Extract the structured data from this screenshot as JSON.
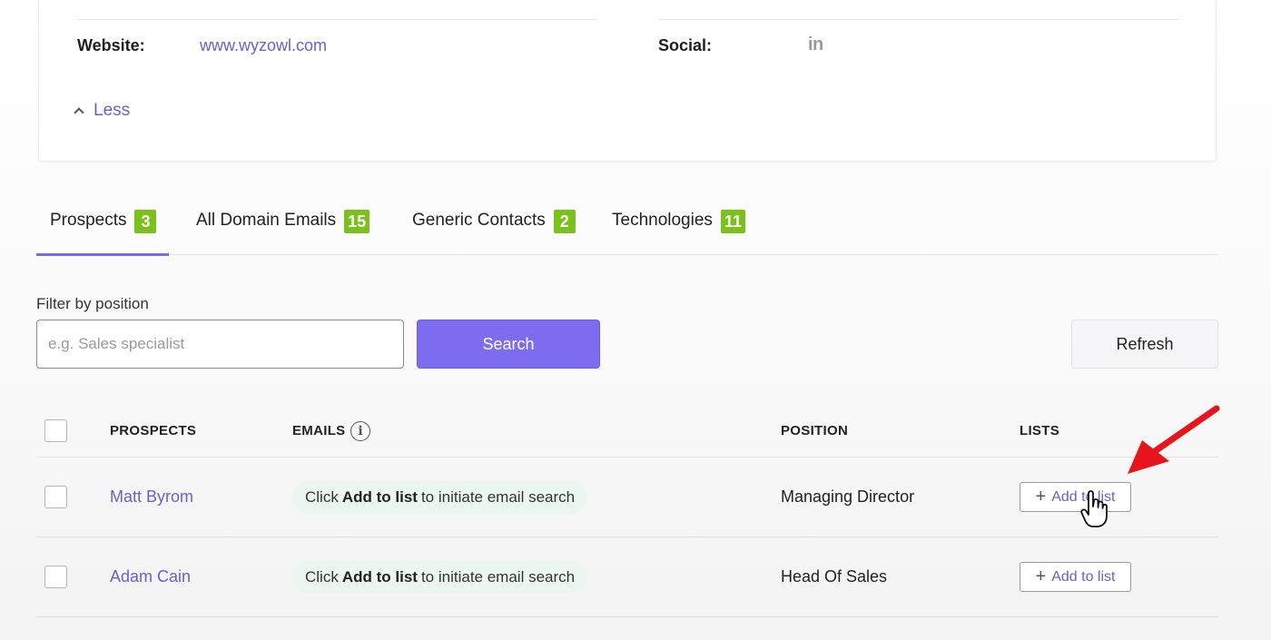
{
  "details": {
    "website_label": "Website:",
    "website_value": "www.wyzowl.com",
    "social_label": "Social:",
    "social_icon": "linkedin-icon",
    "social_text": "in",
    "less_label": "Less"
  },
  "tabs": [
    {
      "label": "Prospects",
      "count": "3",
      "active": true
    },
    {
      "label": "All Domain Emails",
      "count": "15",
      "active": false
    },
    {
      "label": "Generic Contacts",
      "count": "2",
      "active": false
    },
    {
      "label": "Technologies",
      "count": "11",
      "active": false
    }
  ],
  "filter": {
    "label": "Filter by position",
    "placeholder": "e.g. Sales specialist",
    "value": "",
    "search_label": "Search",
    "refresh_label": "Refresh"
  },
  "table": {
    "headers": [
      "PROSPECTS",
      "EMAILS",
      "POSITION",
      "LISTS"
    ],
    "rows": [
      {
        "name": "Matt Byrom",
        "email_prefix": "Click",
        "email_bold": "Add to list",
        "email_suffix": "to initiate email search",
        "position": "Managing Director",
        "list_button": "Add to list"
      },
      {
        "name": "Adam Cain",
        "email_prefix": "Click",
        "email_bold": "Add to list",
        "email_suffix": "to initiate email search",
        "position": "Head Of Sales",
        "list_button": "Add to list"
      }
    ]
  },
  "colors": {
    "accent": "#7c6cf0",
    "link": "#6a5fd0",
    "badge": "#7bc11c",
    "pill_bg": "#eaf6ee",
    "annotation_arrow": "#e8141c"
  }
}
